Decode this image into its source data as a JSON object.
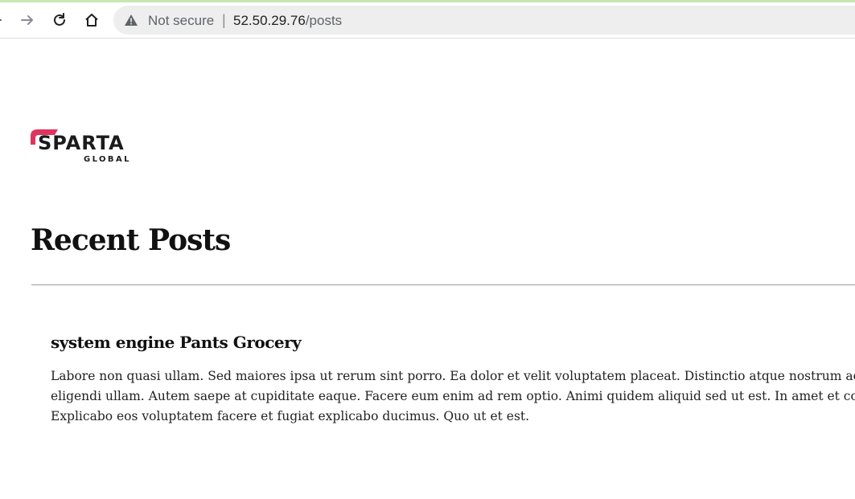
{
  "browser": {
    "security_label": "Not secure",
    "separator": "|",
    "url_host": "52.50.29.76",
    "url_path": "/posts",
    "icons": [
      "back-icon",
      "forward-icon",
      "reload-icon",
      "home-icon",
      "warning-icon"
    ]
  },
  "logo": {
    "main": "SPARTA",
    "sub": "GLOBAL",
    "accent_color": "#e0345e"
  },
  "page": {
    "title": "Recent Posts"
  },
  "posts": [
    {
      "title": "system engine Pants Grocery",
      "body_lines": [
        "Labore non quasi ullam. Sed maiores ipsa ut rerum sint porro. Ea dolor et velit voluptatem placeat. Distinctio atque nostrum acc",
        "eligendi ullam. Autem saepe at cupiditate eaque. Facere eum enim ad rem optio. Animi quidem aliquid sed ut est. In amet et corp",
        "Explicabo eos voluptatem facere et fugiat explicabo ducimus. Quo ut et est."
      ]
    }
  ]
}
